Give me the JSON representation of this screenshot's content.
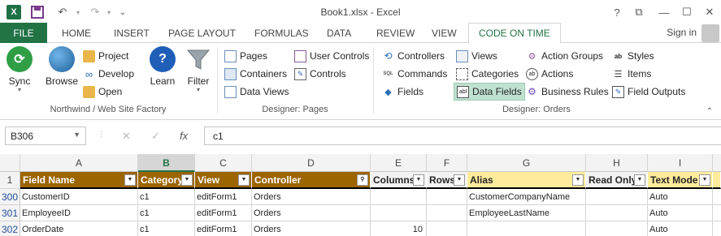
{
  "window": {
    "title": "Book1.xlsx - Excel",
    "controls": [
      "?",
      "⧉",
      "—",
      "☐",
      "✕"
    ]
  },
  "quick_access": {
    "undo": "↶",
    "redo": "↷",
    "customize": "⌄"
  },
  "tabs": {
    "file": "FILE",
    "items": [
      "HOME",
      "INSERT",
      "PAGE LAYOUT",
      "FORMULAS",
      "DATA",
      "REVIEW",
      "VIEW"
    ],
    "active": "CODE ON TIME",
    "signin": "Sign in"
  },
  "ribbon": {
    "group1": {
      "label": "Northwind / Web Site Factory",
      "sync": "Sync",
      "browse": "Browse",
      "project": "Project",
      "develop": "Develop",
      "open": "Open",
      "learn": "Learn",
      "filter": "Filter"
    },
    "group2": {
      "label": "Designer: Pages",
      "pages": "Pages",
      "containers": "Containers",
      "data_views": "Data Views",
      "user_controls": "User Controls",
      "controls": "Controls"
    },
    "group3": {
      "label": "Designer: Orders",
      "controllers": "Controllers",
      "commands": "Commands",
      "fields": "Fields",
      "views": "Views",
      "categories": "Categories",
      "data_fields": "Data Fields",
      "action_groups": "Action Groups",
      "actions": "Actions",
      "business_rules": "Business Rules",
      "styles": "Styles",
      "items": "Items",
      "field_outputs": "Field Outputs"
    }
  },
  "formula_bar": {
    "name_box": "B306",
    "cancel": "✕",
    "enter": "✓",
    "fx": "fx",
    "value": "c1"
  },
  "grid": {
    "columns": [
      "A",
      "B",
      "C",
      "D",
      "E",
      "F",
      "G",
      "H",
      "I"
    ],
    "selected_column": "B",
    "header_row_number": "1",
    "headers": [
      "Field Name",
      "Category",
      "View",
      "Controller",
      "Columns",
      "Rows",
      "Alias",
      "Read Only",
      "Text Mode"
    ],
    "rows": [
      {
        "num": "300",
        "cells": [
          "CustomerID",
          "c1",
          "editForm1",
          "Orders",
          "",
          "",
          "CustomerCompanyName",
          "",
          "Auto"
        ]
      },
      {
        "num": "301",
        "cells": [
          "EmployeeID",
          "c1",
          "editForm1",
          "Orders",
          "",
          "",
          "EmployeeLastName",
          "",
          "Auto"
        ]
      },
      {
        "num": "302",
        "cells": [
          "OrderDate",
          "c1",
          "editForm1",
          "Orders",
          "10",
          "",
          "",
          "",
          "Auto"
        ]
      }
    ]
  },
  "colors": {
    "excel_green": "#217346",
    "header_brown": "#9c6500",
    "header_yellow": "#ffeb9c",
    "selected_button": "#bfe1d0"
  }
}
